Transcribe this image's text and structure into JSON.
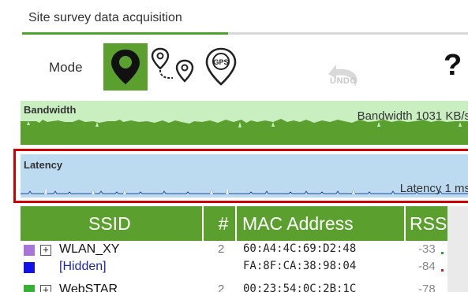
{
  "tab": {
    "title": "Site survey data acquisition"
  },
  "mode": {
    "label": "Mode",
    "buttons": [
      {
        "name": "stop-and-go",
        "icon": "map-pin-icon",
        "active": true
      },
      {
        "name": "continuous",
        "icon": "route-pins-icon",
        "active": false
      },
      {
        "name": "gps",
        "icon": "gps-pin-icon",
        "active": false
      }
    ]
  },
  "toolbar": {
    "undo_label": "UNDO",
    "help_label": "?"
  },
  "bandwidth": {
    "title": "Bandwidth",
    "value_label": "Bandwidth 1031 KB/s",
    "fill_color": "#5ba02e",
    "bg_color": "#c9efc1"
  },
  "latency": {
    "title": "Latency",
    "value_label": "Latency 1 ms",
    "line_color": "#1f4e9e",
    "bg_color": "#bcdbf0"
  },
  "table": {
    "columns": [
      "SSID",
      "#",
      "MAC Address",
      "RSS"
    ],
    "rows": [
      {
        "color": "#a874d9",
        "expandable": true,
        "expand_symbol": "+",
        "ssid": "WLAN_XY",
        "count": "2",
        "mac": "60:A4:4C:69:D2:48",
        "rss": "-33",
        "rss_color": "#2f9d2f"
      },
      {
        "color": "#1212e8",
        "expandable": false,
        "ssid": "[Hidden]",
        "count": "",
        "mac": "FA:8F:CA:38:98:04",
        "rss": "-84",
        "rss_color": "#d11c1c"
      },
      {
        "color": "#38b038",
        "expandable": true,
        "expand_symbol": "+",
        "ssid": "WebSTAR",
        "count": "2",
        "mac": "00:23:54:0C:2B:1C",
        "rss": "-78",
        "rss_color": "#d11c1c"
      }
    ]
  }
}
